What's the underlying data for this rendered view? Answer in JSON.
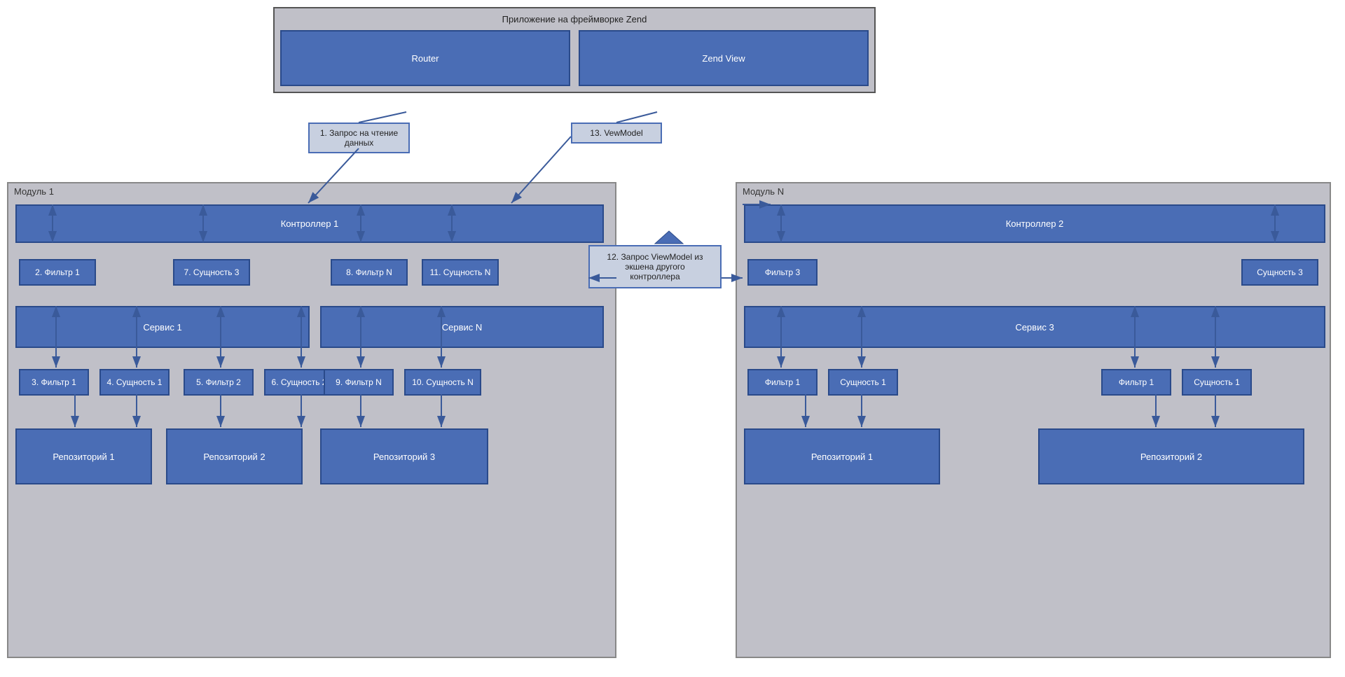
{
  "app": {
    "title": "Приложение на фреймворке Zend",
    "router_label": "Router",
    "zendview_label": "Zend View"
  },
  "callouts": {
    "c1": "1. Запрос на чтение\nданных",
    "c13": "13. VewModel",
    "c12": "12. Запрос ViewModel из\nэкшена другого\nконтроллера"
  },
  "module1": {
    "label": "Модуль 1",
    "controller": "Контроллер 1",
    "filter2": "2. Фильтр 1",
    "entity7": "7. Сущность 3",
    "filter8": "8. Фильтр N",
    "entity11": "11. Сущность N",
    "service1": "Сервис 1",
    "serviceN": "Сервис N",
    "filter3": "3. Фильтр 1",
    "entity4": "4. Сущность 1",
    "filter5": "5. Фильтр 2",
    "entity6": "6. Сущность 2",
    "filter9": "9. Фильтр N",
    "entity10": "10. Сущность N",
    "repo1": "Репозиторий 1",
    "repo2": "Репозиторий 2",
    "repo3": "Репозиторий 3"
  },
  "moduleN": {
    "label": "Модуль N",
    "controller": "Контроллер 2",
    "filter3": "Фильтр 3",
    "entity3": "Сущность 3",
    "service3": "Сервис 3",
    "filter1a": "Фильтр 1",
    "entity1a": "Сущность 1",
    "filter1b": "Фильтр 1",
    "entity1b": "Сущность 1",
    "repo1": "Репозиторий 1",
    "repo2": "Репозиторий 2"
  }
}
